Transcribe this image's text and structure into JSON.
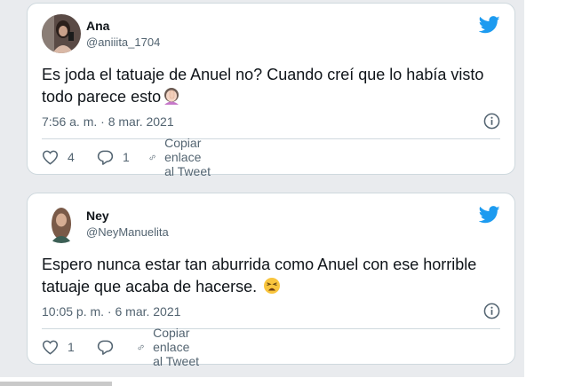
{
  "tweets": [
    {
      "author_name": "Ana",
      "author_handle": "@aniiita_1704",
      "text": "Es joda el tatuaje de Anuel no? Cuando creí que lo había visto todo parece esto",
      "emoji_icon": "woman-facepalming-emoji",
      "timestamp": "7:56 a. m. · 8 mar. 2021",
      "likes": "4",
      "replies": "1",
      "copy_link_label": "Copiar enlace al Tweet"
    },
    {
      "author_name": "Ney",
      "author_handle": "@NeyManuelita",
      "text": "Espero nunca estar tan aburrida como Anuel con ese horrible tatuaje que acaba de hacerse.",
      "emoji_icon": "weary-face-emoji",
      "timestamp": "10:05 p. m. · 6 mar. 2021",
      "likes": "1",
      "replies": "",
      "copy_link_label": "Copiar enlace al Tweet"
    }
  ],
  "colors": {
    "brand_blue": "#1d9bf0",
    "text_primary": "#0f1419",
    "text_secondary": "#536471",
    "border": "#cfd9de",
    "page_shade": "#e9ebee"
  }
}
